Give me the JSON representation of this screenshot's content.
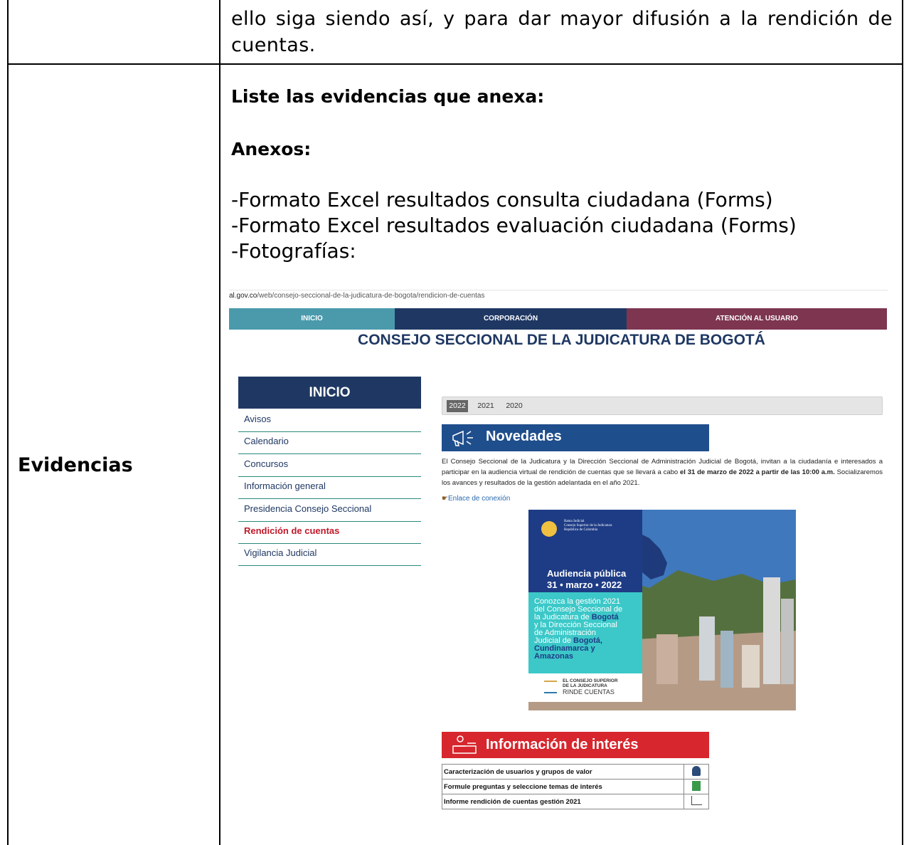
{
  "top_row": {
    "text": "ello siga siendo así, y para dar mayor difusión a la rendición de cuentas."
  },
  "evidence_row": {
    "label": "Evidencias",
    "list_heading": "Liste las evidencias que anexa:",
    "annex_heading": "Anexos:",
    "annexes": [
      "-Formato Excel resultados consulta ciudadana (Forms)",
      "-Formato Excel resultados evaluación ciudadana (Forms)",
      "-Fotografías:"
    ]
  },
  "screenshot": {
    "url_host": "al.gov.co",
    "url_path": "/web/consejo-seccional-de-la-judicatura-de-bogota/rendicion-de-cuentas",
    "nav": [
      "INICIO",
      "CORPORACIÓN",
      "ATENCIÓN AL USUARIO"
    ],
    "site_title": "CONSEJO SECCIONAL DE LA JUDICATURA DE BOGOTÁ",
    "sidebar": {
      "title": "INICIO",
      "items": [
        "Avisos",
        "Calendario",
        "Concursos",
        "Información general",
        "Presidencia Consejo Seccional",
        "Rendición de cuentas",
        "Vigilancia Judicial"
      ],
      "active_item": "Rendición de cuentas"
    },
    "years": [
      "2022",
      "2021",
      "2020"
    ],
    "selected_year": "2022",
    "news_title": "Novedades",
    "news_text_1": "El Consejo Seccional de la Judicatura y la Dirección Seccional de Administración Judicial de Bogotá, invitan a la ciudadanía e interesados a participar en la audiencia virtual de rendición de cuentas que se llevará a cabo ",
    "news_text_bold": "el 31 de marzo de 2022 a partir de las 10:00 a.m.",
    "news_text_2": " Socializaremos los avances y resultados de la gestión adelantada en el año 2021.",
    "link_label": "Enlace de conexión",
    "poster": {
      "org_line1": "Rama Judicial",
      "org_line2": "Consejo Superior de la Judicatura",
      "org_line3": "República de Colombia",
      "event_title": "Audiencia pública",
      "event_date": "31 • marzo • 2022",
      "desc_line1": "Conozca la gestión 2021",
      "desc_line2": "del Consejo Seccional de",
      "desc_line3": "la Judicatura de ",
      "desc_bold1": "Bogotá",
      "desc_line4": "y la Dirección Seccional",
      "desc_line5": "de Administración",
      "desc_line6": "Judicial de ",
      "desc_bold2": "Bogotá,",
      "desc_bold3": "Cundinamarca y",
      "desc_bold4": "Amazonas",
      "footer_line1": "EL CONSEJO SUPERIOR",
      "footer_line2": "DE LA JUDICATURA",
      "footer_line3": "RINDE CUENTAS"
    },
    "info_title": "Información de interés",
    "info_items": [
      {
        "label": "Caracterización de usuarios y grupos de valor",
        "icon": "user-icon"
      },
      {
        "label": "Formule preguntas y seleccione temas de interés",
        "icon": "question-user-icon"
      },
      {
        "label": "Informe rendición de cuentas gestión 2021",
        "icon": "chart-icon"
      }
    ],
    "colors": {
      "nav_inicio": "#4a9aac",
      "nav_corporacion": "#1f3863",
      "nav_atencion": "#7d3550",
      "novedades_bg": "#1f4e8c",
      "info_bg": "#d7262d",
      "active_item": "#c0182a"
    }
  }
}
